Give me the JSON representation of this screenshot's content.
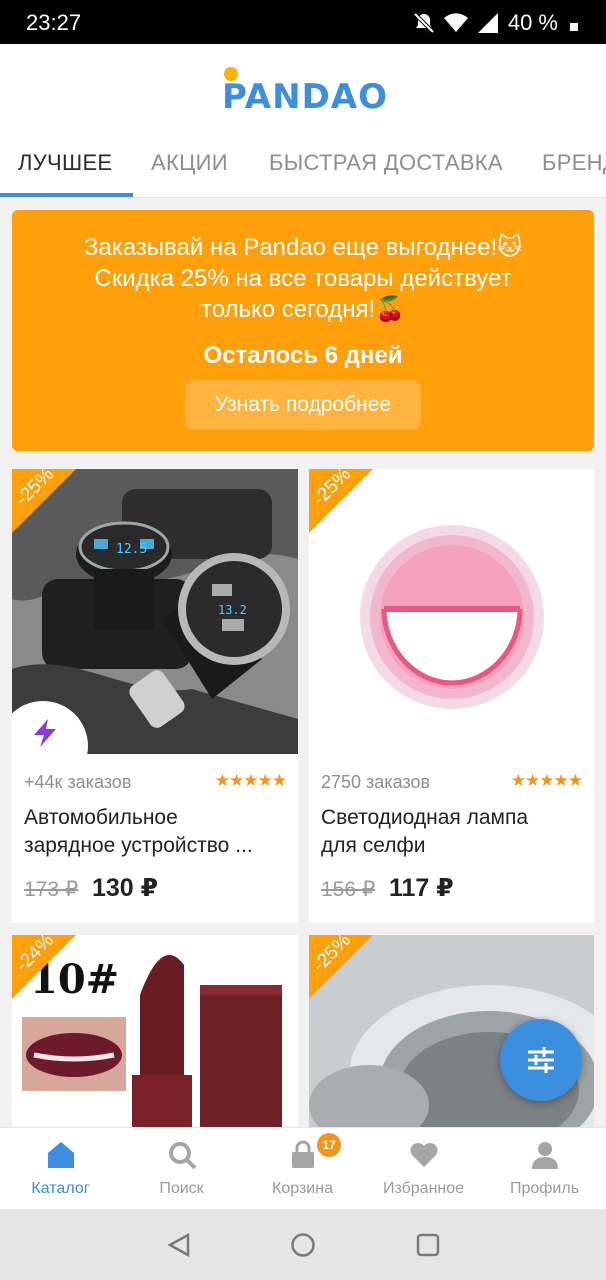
{
  "status": {
    "time": "23:27",
    "battery": "40 %"
  },
  "header": {
    "logo_text": "PANDAO"
  },
  "tabs": [
    {
      "label": "ЛУЧШЕЕ",
      "active": true
    },
    {
      "label": "АКЦИИ",
      "active": false
    },
    {
      "label": "БЫСТРАЯ ДОСТАВКА",
      "active": false
    },
    {
      "label": "БРЕНДЫ",
      "active": false
    }
  ],
  "promo": {
    "line1": "Заказывай на Pandao еще выгоднее!🐱",
    "line2": "Скидка 25% на все товары действует",
    "line3": "только сегодня!🍒",
    "days_left": "Осталось 6 дней",
    "button_label": "Узнать подробнее"
  },
  "products": [
    {
      "discount": "-25%",
      "orders": "+44к заказов",
      "stars": "★★★★★",
      "rating": 4.5,
      "title_line1": "Автомобильное",
      "title_line2": "зарядное устройство ...",
      "old_price": "173 ₽",
      "price": "130 ₽",
      "image": "car-charger"
    },
    {
      "discount": "-25%",
      "orders": "2750 заказов",
      "stars": "★★★★★",
      "rating": 4.5,
      "title_line1": "Светодиодная лампа",
      "title_line2": "для селфи",
      "old_price": "156 ₽",
      "price": "117 ₽",
      "image": "selfie-ring-light"
    },
    {
      "discount": "-24%",
      "image": "lipstick",
      "image_text": "10#"
    },
    {
      "discount": "-25%",
      "image": "sink-strainer"
    }
  ],
  "bottom_nav": [
    {
      "label": "Каталог",
      "icon": "home-icon",
      "active": true
    },
    {
      "label": "Поиск",
      "icon": "search-icon",
      "active": false
    },
    {
      "label": "Корзина",
      "icon": "bag-icon",
      "active": false,
      "badge": "17"
    },
    {
      "label": "Избранное",
      "icon": "heart-icon",
      "active": false
    },
    {
      "label": "Профиль",
      "icon": "profile-icon",
      "active": false
    }
  ],
  "colors": {
    "accent": "#3c8fde",
    "promo": "#ff9f0a",
    "badge": "#f7941d"
  }
}
